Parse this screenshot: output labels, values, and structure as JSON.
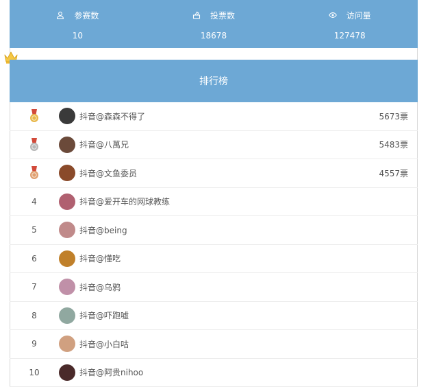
{
  "stats": [
    {
      "label": "参赛数",
      "value": "10",
      "icon": "user-icon"
    },
    {
      "label": "投票数",
      "value": "18678",
      "icon": "ballot-icon"
    },
    {
      "label": "访问量",
      "value": "127478",
      "icon": "eye-icon"
    }
  ],
  "ranking": {
    "title": "排行榜",
    "rows": [
      {
        "rank": "1",
        "name": "抖音@森森不得了",
        "votes": "5673票",
        "medal": "gold",
        "avatar_color": "#3a3a3a"
      },
      {
        "rank": "2",
        "name": "抖音@八萬兄",
        "votes": "5483票",
        "medal": "silver",
        "avatar_color": "#6b4a3a"
      },
      {
        "rank": "3",
        "name": "抖音@文鱼委员",
        "votes": "4557票",
        "medal": "bronze",
        "avatar_color": "#8a4a2a"
      },
      {
        "rank": "4",
        "name": "抖音@爱开车的网球教练",
        "votes": "",
        "medal": "",
        "avatar_color": "#b06070"
      },
      {
        "rank": "5",
        "name": "抖音@being",
        "votes": "",
        "medal": "",
        "avatar_color": "#c08a8a"
      },
      {
        "rank": "6",
        "name": "抖音@懂吃",
        "votes": "",
        "medal": "",
        "avatar_color": "#c0802a"
      },
      {
        "rank": "7",
        "name": "抖音@乌鸦",
        "votes": "",
        "medal": "",
        "avatar_color": "#c090a8"
      },
      {
        "rank": "8",
        "name": "抖音@吓跑嘘",
        "votes": "",
        "medal": "",
        "avatar_color": "#90a8a0"
      },
      {
        "rank": "9",
        "name": "抖音@小白咕",
        "votes": "",
        "medal": "",
        "avatar_color": "#d0a080"
      },
      {
        "rank": "10",
        "name": "抖音@阿贵nihoo",
        "votes": "",
        "medal": "",
        "avatar_color": "#4a2a2a"
      }
    ]
  },
  "colors": {
    "header_blue": "#6da8d5",
    "gold": "#e8b84a",
    "silver": "#b8b8b8",
    "bronze": "#e0a070"
  }
}
